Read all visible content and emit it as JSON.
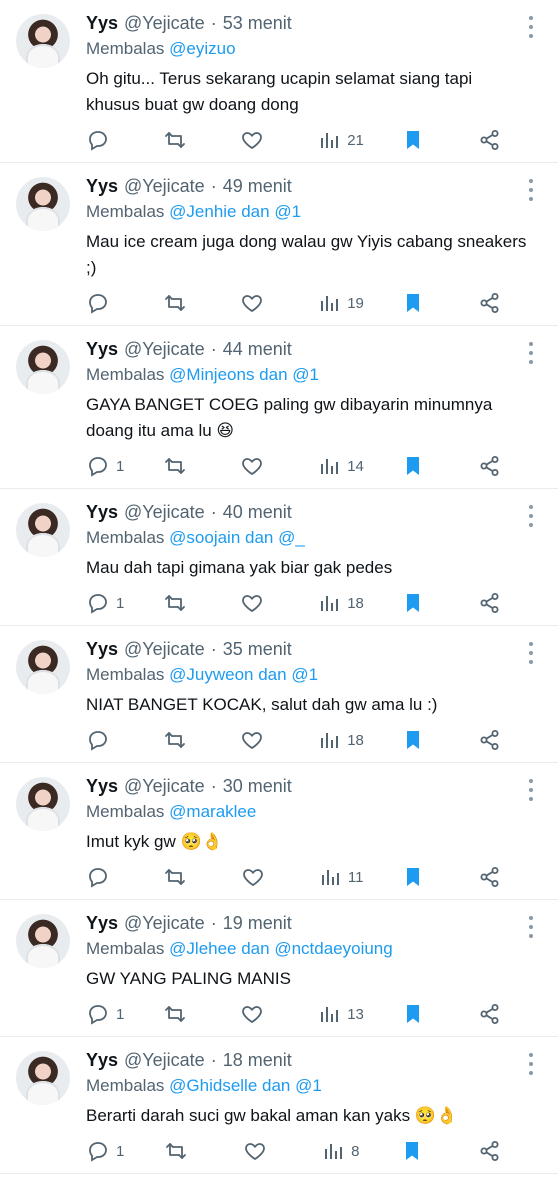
{
  "tweets": [
    {
      "name": "Yys",
      "handle": "@Yejicate",
      "time": "53 menit",
      "replying_prefix": "Membalas",
      "replying_to": "@eyizuo",
      "text": "Oh gitu... Terus sekarang ucapin selamat siang tapi khusus buat gw doang dong",
      "reply_count": "",
      "views": "21"
    },
    {
      "name": "Yys",
      "handle": "@Yejicate",
      "time": "49 menit",
      "replying_prefix": "Membalas",
      "replying_to": "@Jenhie dan @1",
      "text": "Mau ice cream juga dong walau gw Yiyis cabang sneakers ;)",
      "reply_count": "",
      "views": "19"
    },
    {
      "name": "Yys",
      "handle": "@Yejicate",
      "time": "44 menit",
      "replying_prefix": "Membalas",
      "replying_to": "@Minjeons dan @1",
      "text": "GAYA BANGET COEG paling gw dibayarin minumnya doang itu ama lu 😆",
      "reply_count": "1",
      "views": "14"
    },
    {
      "name": "Yys",
      "handle": "@Yejicate",
      "time": "40 menit",
      "replying_prefix": "Membalas",
      "replying_to": "@soojain dan @_",
      "text": "Mau dah tapi gimana yak biar gak pedes",
      "reply_count": "1",
      "views": "18"
    },
    {
      "name": "Yys",
      "handle": "@Yejicate",
      "time": "35 menit",
      "replying_prefix": "Membalas",
      "replying_to": "@Juyweon dan @1",
      "text": "NIAT BANGET KOCAK, salut dah gw ama lu :)",
      "reply_count": "",
      "views": "18"
    },
    {
      "name": "Yys",
      "handle": "@Yejicate",
      "time": "30 menit",
      "replying_prefix": "Membalas",
      "replying_to": "@maraklee",
      "text": "Imut kyk gw 🥺👌",
      "reply_count": "",
      "views": "11"
    },
    {
      "name": "Yys",
      "handle": "@Yejicate",
      "time": "19 menit",
      "replying_prefix": "Membalas",
      "replying_to": "@Jlehee dan @nctdaeyoiung",
      "text": "GW YANG PALING MANIS",
      "reply_count": "1",
      "views": "13"
    },
    {
      "name": "Yys",
      "handle": "@Yejicate",
      "time": "18 menit",
      "replying_prefix": "Membalas",
      "replying_to": "@Ghidselle dan @1",
      "text": "Berarti darah suci gw bakal aman kan yaks 🥺👌",
      "reply_count": "1",
      "views": "8"
    }
  ],
  "icons": {
    "reply": "reply-icon",
    "retweet": "retweet-icon",
    "like": "heart-icon",
    "views": "views-icon",
    "bookmark": "bookmark-icon",
    "share": "share-icon",
    "more": "more-icon"
  },
  "colors": {
    "accent": "#1d9bf0",
    "muted": "#536471",
    "text": "#0f1419",
    "divider": "#e6ecf0"
  }
}
